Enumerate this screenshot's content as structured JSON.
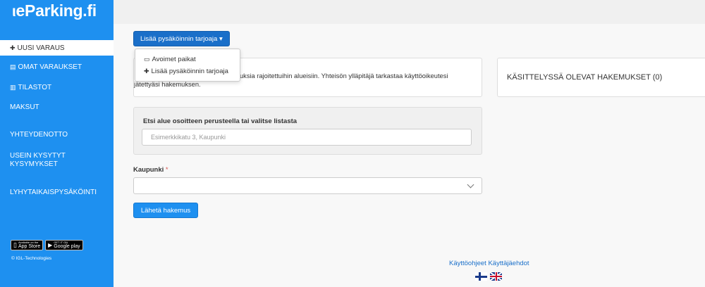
{
  "brand": {
    "logo_prefix": "ι",
    "logo_text": "eParking.fi"
  },
  "sidebar": {
    "items": [
      {
        "icon": "plus-circle-icon",
        "icon_glyph": "✚",
        "label": "UUSI VARAUS"
      },
      {
        "icon": "id-card-icon",
        "icon_glyph": "▤",
        "label": "OMAT VARAUKSET"
      },
      {
        "icon": "bar-chart-icon",
        "icon_glyph": "▥",
        "label": "TILASTOT"
      },
      {
        "label": "MAKSUT"
      },
      {
        "label": "YHTEYDENOTTO"
      },
      {
        "label": "USEIN KYSYTYT",
        "label2": "KYSYMYKSET"
      },
      {
        "label": "LYHYTAIKAISPYSÄKÖINTI"
      }
    ],
    "app_store": {
      "small": "Available on the",
      "label": "App Store"
    },
    "google_play": {
      "small": "GET IT ON",
      "label": "Google play"
    },
    "copyright": "© IGL-Technologies"
  },
  "main": {
    "dropdown_button": "Lisää pysäköinnin tarjoaja ▾",
    "dropdown_menu": [
      {
        "icon": "map-icon",
        "icon_glyph": "🗺",
        "label": "Avoimet paikat"
      },
      {
        "icon": "plus-icon",
        "icon_glyph": "✚",
        "label": "Lisää pysäköinnin tarjoaja"
      }
    ],
    "info_text_line1": "uksia rajoitettuihin alueisiin. Yhteisön ylläpitäjä tarkastaa käyttöoikeutesi",
    "info_text_line2": "jätettyäsi hakemuksen.",
    "pending_title": "KÄSITTELYSSÄ OLEVAT HAKEMUKSET (0)",
    "search": {
      "label": "Etsi alue osoitteen perusteella tai valitse listasta",
      "placeholder": "Esimerkkikatu 3, Kaupunki"
    },
    "city": {
      "label": "Kaupunki",
      "required_mark": "*",
      "selected": ""
    },
    "submit_label": "Lähetä hakemus"
  },
  "footer": {
    "links": "Käyttöohjeet Käyttäjäehdot",
    "languages": [
      "fi",
      "en"
    ]
  },
  "colors": {
    "sidebar": "#1e90f0",
    "primary_button": "#1a6fc9",
    "link": "#1a6fc9"
  }
}
